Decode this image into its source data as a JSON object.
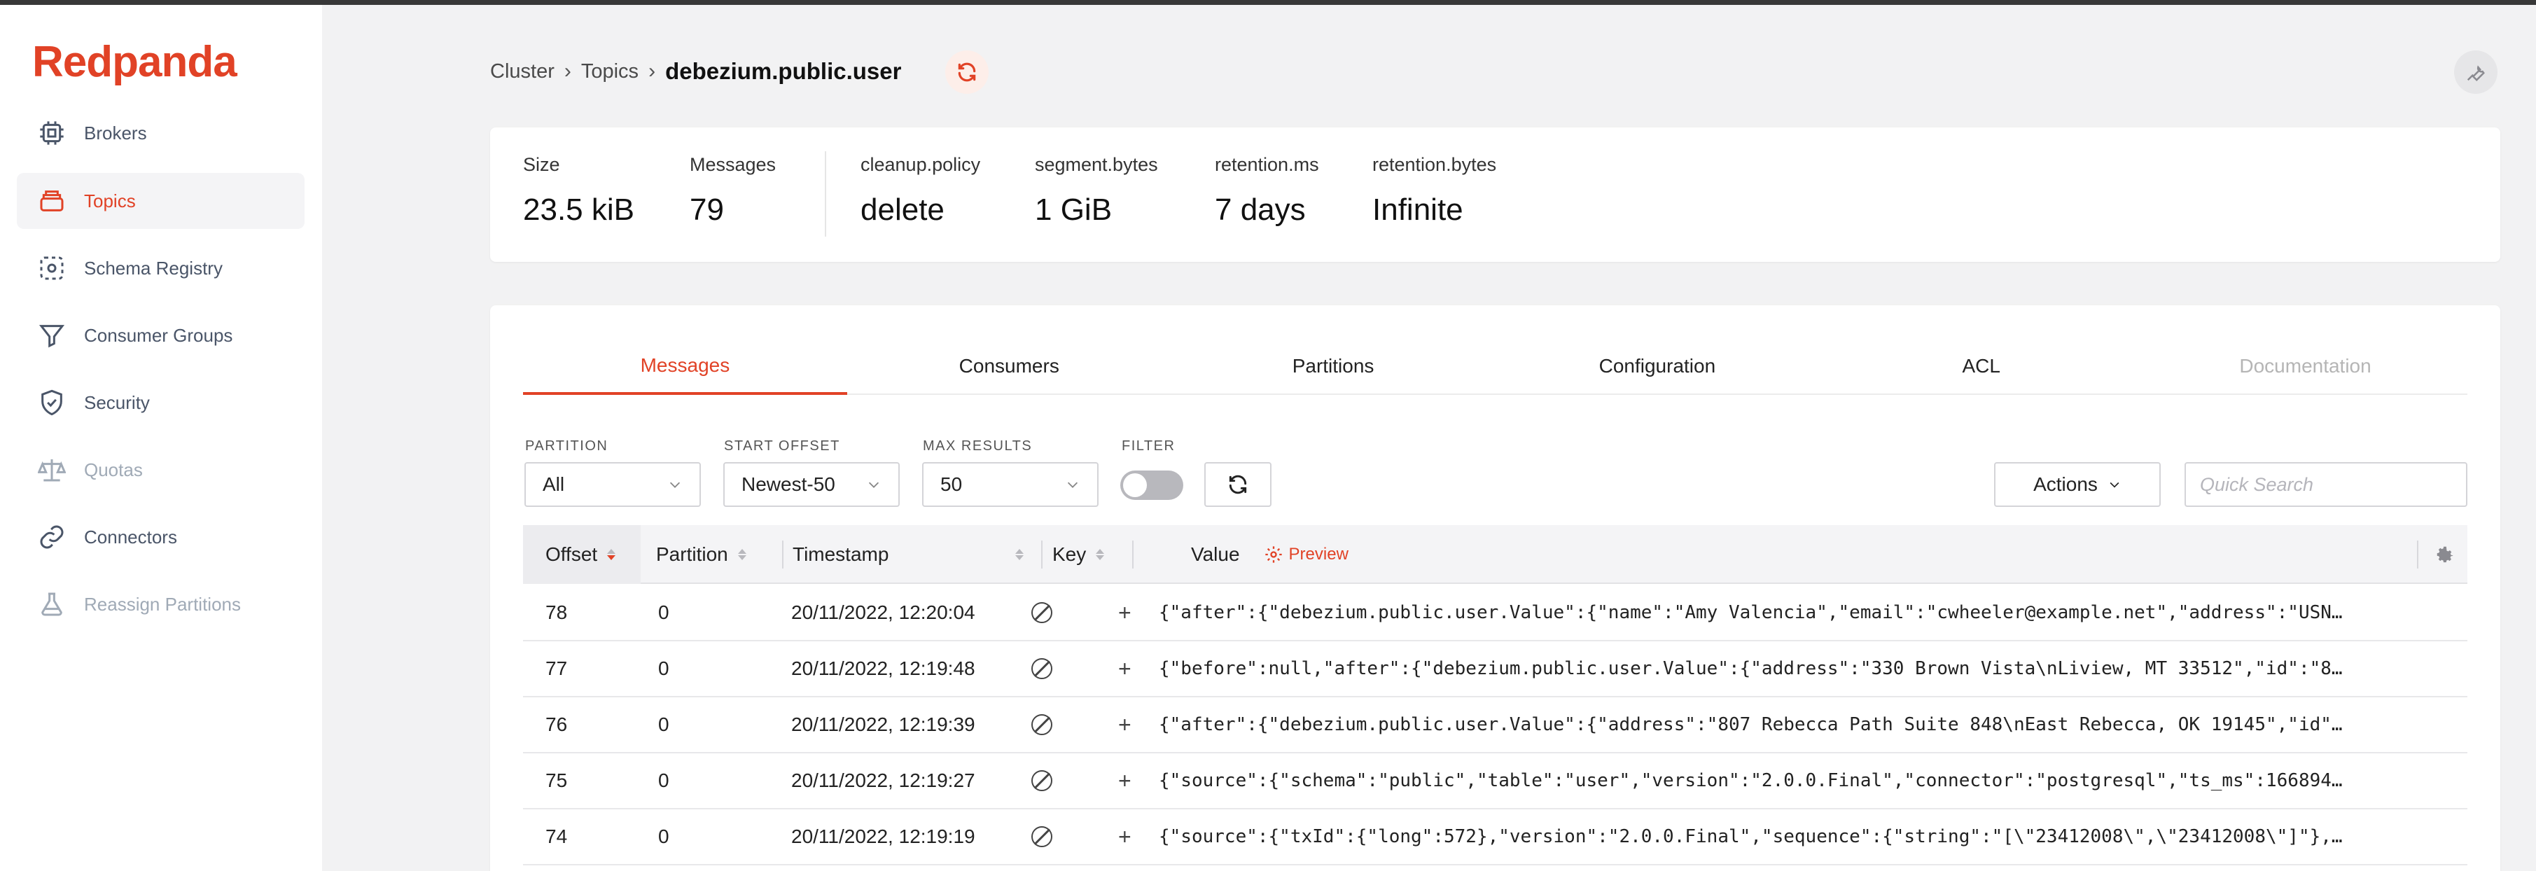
{
  "brand": {
    "name": "Redpanda",
    "color": "#e14226"
  },
  "sidebar": {
    "items": [
      {
        "label": "Brokers",
        "icon": "chip-icon",
        "state": "normal"
      },
      {
        "label": "Topics",
        "icon": "stack-icon",
        "state": "active"
      },
      {
        "label": "Schema Registry",
        "icon": "dotted-box-icon",
        "state": "normal"
      },
      {
        "label": "Consumer Groups",
        "icon": "funnel-icon",
        "state": "normal"
      },
      {
        "label": "Security",
        "icon": "shield-icon",
        "state": "normal"
      },
      {
        "label": "Quotas",
        "icon": "scale-icon",
        "state": "disabled"
      },
      {
        "label": "Connectors",
        "icon": "link-icon",
        "state": "normal"
      },
      {
        "label": "Reassign Partitions",
        "icon": "flask-icon",
        "state": "disabled"
      }
    ]
  },
  "breadcrumb": {
    "cluster": "Cluster",
    "topics": "Topics",
    "current": "debezium.public.user"
  },
  "stats": {
    "size": {
      "label": "Size",
      "value": "23.5 kiB"
    },
    "messages": {
      "label": "Messages",
      "value": "79"
    },
    "cleanup_policy": {
      "label": "cleanup.policy",
      "value": "delete"
    },
    "segment_bytes": {
      "label": "segment.bytes",
      "value": "1 GiB"
    },
    "retention_ms": {
      "label": "retention.ms",
      "value": "7 days"
    },
    "retention_bytes": {
      "label": "retention.bytes",
      "value": "Infinite"
    }
  },
  "tabs": [
    {
      "label": "Messages",
      "state": "active"
    },
    {
      "label": "Consumers",
      "state": "normal"
    },
    {
      "label": "Partitions",
      "state": "normal"
    },
    {
      "label": "Configuration",
      "state": "normal"
    },
    {
      "label": "ACL",
      "state": "normal"
    },
    {
      "label": "Documentation",
      "state": "disabled"
    }
  ],
  "filters": {
    "partition": {
      "label": "PARTITION",
      "value": "All"
    },
    "start_offset": {
      "label": "START OFFSET",
      "value": "Newest-50"
    },
    "max_results": {
      "label": "MAX RESULTS",
      "value": "50"
    },
    "filter": {
      "label": "FILTER"
    },
    "actions_label": "Actions",
    "search_placeholder": "Quick Search"
  },
  "table": {
    "headers": {
      "offset": "Offset",
      "partition": "Partition",
      "timestamp": "Timestamp",
      "key": "Key",
      "value": "Value",
      "preview": "Preview"
    },
    "rows": [
      {
        "offset": "78",
        "partition": "0",
        "timestamp": "20/11/2022, 12:20:04",
        "value": "{\"after\":{\"debezium.public.user.Value\":{\"name\":\"Amy Valencia\",\"email\":\"cwheeler@example.net\",\"address\":\"USN…"
      },
      {
        "offset": "77",
        "partition": "0",
        "timestamp": "20/11/2022, 12:19:48",
        "value": "{\"before\":null,\"after\":{\"debezium.public.user.Value\":{\"address\":\"330 Brown Vista\\nLiview, MT 33512\",\"id\":\"8…"
      },
      {
        "offset": "76",
        "partition": "0",
        "timestamp": "20/11/2022, 12:19:39",
        "value": "{\"after\":{\"debezium.public.user.Value\":{\"address\":\"807 Rebecca Path Suite 848\\nEast Rebecca, OK 19145\",\"id\"…"
      },
      {
        "offset": "75",
        "partition": "0",
        "timestamp": "20/11/2022, 12:19:27",
        "value": "{\"source\":{\"schema\":\"public\",\"table\":\"user\",\"version\":\"2.0.0.Final\",\"connector\":\"postgresql\",\"ts_ms\":166894…"
      },
      {
        "offset": "74",
        "partition": "0",
        "timestamp": "20/11/2022, 12:19:19",
        "value": "{\"source\":{\"txId\":{\"long\":572},\"version\":\"2.0.0.Final\",\"sequence\":{\"string\":\"[\\\"23412008\\\",\\\"23412008\\\"]\"},…"
      }
    ]
  }
}
